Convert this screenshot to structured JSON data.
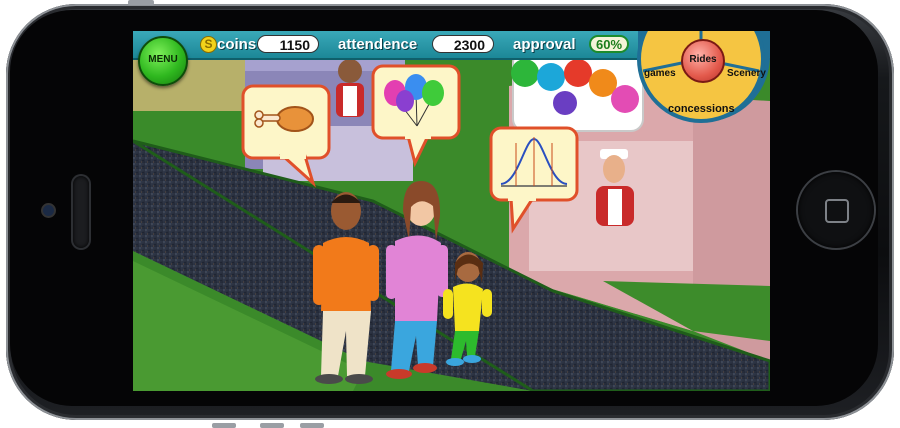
{
  "hud": {
    "coins_label": "coins",
    "coins_icon_glyph": "S",
    "coins_value": "1150",
    "attendance_label": "attendence",
    "attendance_value": "2300",
    "approval_label": "approval",
    "approval_value": "60%"
  },
  "menu": {
    "label": "MENU"
  },
  "category_wheel": {
    "center_label": "Rides",
    "left_label": "games",
    "right_label": "Scenery",
    "bottom_label": "concessions"
  },
  "speech_bubbles": [
    {
      "name": "food-bubble",
      "icon": "chicken-leg-icon"
    },
    {
      "name": "balloon-bubble",
      "icon": "balloons-icon"
    },
    {
      "name": "chart-bubble",
      "icon": "bell-curve-chart-icon"
    }
  ],
  "colors": {
    "hud_bar": "#2a9aab",
    "menu_button": "#2fb81f",
    "rides_button": "#e35a4c",
    "wheel": "#f5c542",
    "bubble_border": "#e0502a",
    "path": "#2b3240",
    "grass": "#3b8a2a"
  }
}
